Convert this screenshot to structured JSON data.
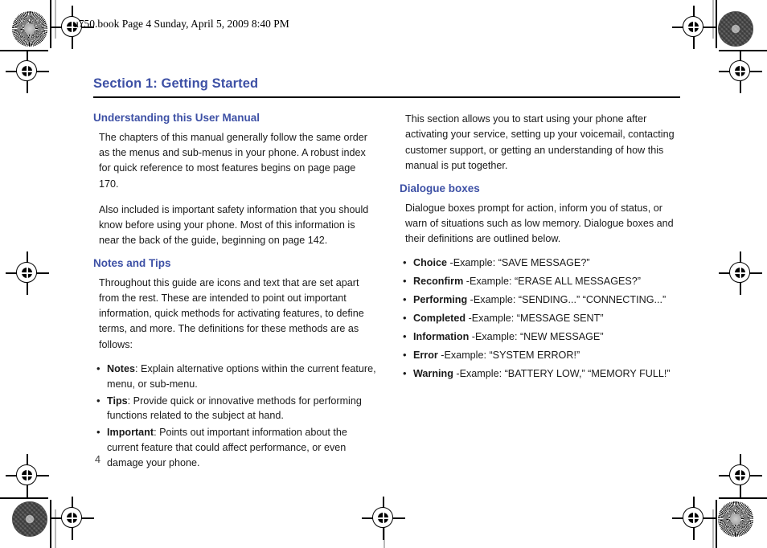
{
  "running_header": "u750.book  Page 4  Sunday, April 5, 2009  8:40 PM",
  "page_number": "4",
  "colors": {
    "heading_blue": "#3d50a5",
    "rule_black": "#000000",
    "body_text": "#1a1a1a"
  },
  "section": {
    "title": "Section 1: Getting Started"
  },
  "left_column": {
    "heading_1": "Understanding this User Manual",
    "paragraph_1": "The chapters of this manual generally follow the same order as the menus and sub-menus in your phone. A robust index for quick reference to most features begins on page page 170.",
    "paragraph_2": "Also included is important safety information that you should know before using your phone. Most of this information is near the back of the guide, beginning on page 142.",
    "heading_2": "Notes and Tips",
    "paragraph_3": "Throughout this guide are icons and text that are set apart from the rest. These are intended to point out important information, quick methods for activating features, to define terms, and more. The definitions for these methods are as follows:",
    "bullets": [
      {
        "term": "Notes",
        "text": ": Explain alternative options within the current feature, menu, or sub-menu."
      },
      {
        "term": "Tips",
        "text": ": Provide quick or innovative methods for performing functions related to the subject at hand."
      },
      {
        "term": "Important",
        "text": ": Points out important information about the current feature that could affect performance, or even damage your phone."
      }
    ]
  },
  "right_column": {
    "paragraph_1": "This section allows you to start using your phone after activating your service, setting up your voicemail, contacting customer support, or getting an understanding of how this manual is put together.",
    "heading_1": "Dialogue boxes",
    "paragraph_2": "Dialogue boxes prompt for action, inform you of status, or warn of situations such as low memory. Dialogue boxes and their definitions are outlined below.",
    "bullets": [
      {
        "term": "Choice",
        "text": " -Example: “SAVE MESSAGE?”"
      },
      {
        "term": "Reconfirm",
        "text": " -Example: “ERASE ALL MESSAGES?”"
      },
      {
        "term": "Performing",
        "text": " -Example: “SENDING...” “CONNECTING...”"
      },
      {
        "term": "Completed",
        "text": " -Example: “MESSAGE SENT”"
      },
      {
        "term": "Information",
        "text": " -Example: “NEW MESSAGE”"
      },
      {
        "term": "Error",
        "text": " -Example: “SYSTEM ERROR!”"
      },
      {
        "term": "Warning",
        "text": " -Example: “BATTERY LOW,” “MEMORY FULL!”"
      }
    ]
  }
}
